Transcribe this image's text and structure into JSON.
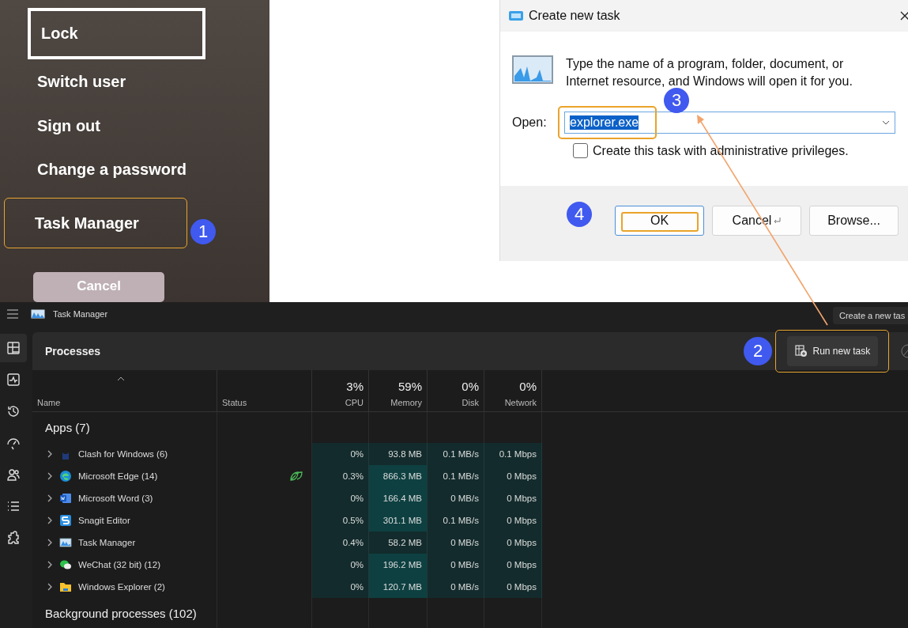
{
  "lock_menu": {
    "items": [
      {
        "label": "Lock",
        "selected": true,
        "highlighted": false
      },
      {
        "label": "Switch user",
        "selected": false,
        "highlighted": false
      },
      {
        "label": "Sign out",
        "selected": false,
        "highlighted": false
      },
      {
        "label": "Change a password",
        "selected": false,
        "highlighted": false
      },
      {
        "label": "Task Manager",
        "selected": false,
        "highlighted": true
      }
    ],
    "step": "1",
    "cancel": "Cancel"
  },
  "dialog": {
    "title": "Create new task",
    "message": "Type the name of a program, folder, document, or Internet resource, and Windows will open it for you.",
    "open_label": "Open:",
    "value": "explorer.exe",
    "value_selected": true,
    "value_highlighted": true,
    "step_input": "3",
    "checkbox": {
      "label": "Create this task with administrative privileges.",
      "checked": false
    },
    "step_buttons": "4",
    "buttons": [
      {
        "label": "OK",
        "kind": "default",
        "highlighted": true
      },
      {
        "label": "Cancel",
        "kind": "cancel",
        "highlighted": false
      },
      {
        "label": "Browse...",
        "kind": "plain",
        "highlighted": false
      }
    ]
  },
  "task_manager": {
    "title": "Task Manager",
    "tooltip": "Create a new tas",
    "sidebar": [
      {
        "kind": "processes",
        "selected": true
      },
      {
        "kind": "performance",
        "selected": false
      },
      {
        "kind": "history",
        "selected": false
      },
      {
        "kind": "startup",
        "selected": false
      },
      {
        "kind": "users",
        "selected": false
      },
      {
        "kind": "details",
        "selected": false
      },
      {
        "kind": "services",
        "selected": false
      }
    ],
    "page_title": "Processes",
    "step": "2",
    "run_button": {
      "label": "Run new task",
      "highlighted": true
    },
    "columns": [
      {
        "label": "Name"
      },
      {
        "label": "Status"
      },
      {
        "label": "CPU",
        "total": "3%"
      },
      {
        "label": "Memory",
        "total": "59%"
      },
      {
        "label": "Disk",
        "total": "0%"
      },
      {
        "label": "Network",
        "total": "0%"
      }
    ],
    "groups": [
      {
        "label": "Apps (7)",
        "rows": [
          {
            "name": "Clash for Windows (6)",
            "kind": "clash",
            "efficiency": false,
            "memory_high": false,
            "cells": [
              "0%",
              "93.8 MB",
              "0.1 MB/s",
              "0.1 Mbps"
            ]
          },
          {
            "name": "Microsoft Edge (14)",
            "kind": "edge",
            "efficiency": true,
            "memory_high": true,
            "cells": [
              "0.3%",
              "866.3 MB",
              "0.1 MB/s",
              "0 Mbps"
            ]
          },
          {
            "name": "Microsoft Word (3)",
            "kind": "word",
            "efficiency": false,
            "memory_high": true,
            "cells": [
              "0%",
              "166.4 MB",
              "0 MB/s",
              "0 Mbps"
            ]
          },
          {
            "name": "Snagit Editor",
            "kind": "snagit",
            "efficiency": false,
            "memory_high": true,
            "cells": [
              "0.5%",
              "301.1 MB",
              "0.1 MB/s",
              "0 Mbps"
            ]
          },
          {
            "name": "Task Manager",
            "kind": "taskmgr",
            "efficiency": false,
            "memory_high": false,
            "cells": [
              "0.4%",
              "58.2 MB",
              "0 MB/s",
              "0 Mbps"
            ]
          },
          {
            "name": "WeChat (32 bit) (12)",
            "kind": "wechat",
            "efficiency": false,
            "memory_high": true,
            "cells": [
              "0%",
              "196.2 MB",
              "0 MB/s",
              "0 Mbps"
            ]
          },
          {
            "name": "Windows Explorer (2)",
            "kind": "explorer",
            "efficiency": false,
            "memory_high": true,
            "cells": [
              "0%",
              "120.7 MB",
              "0 MB/s",
              "0 Mbps"
            ]
          }
        ]
      },
      {
        "label": "Background processes (102)"
      }
    ]
  }
}
